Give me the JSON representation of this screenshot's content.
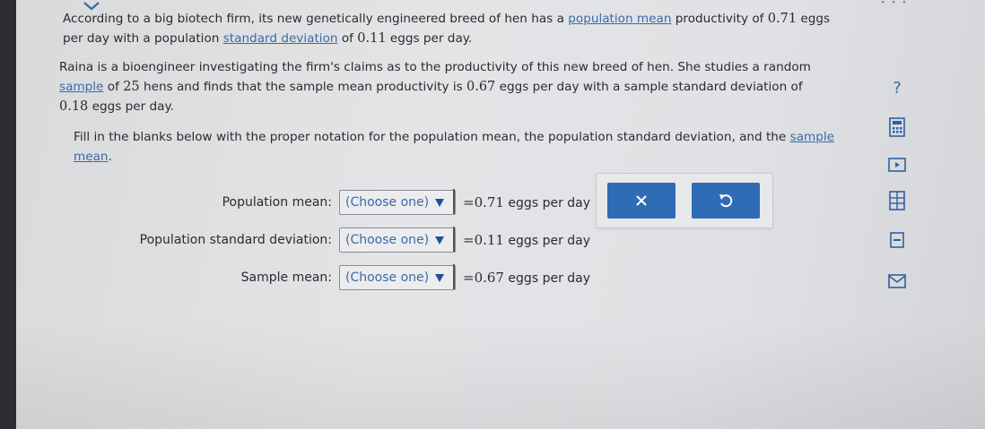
{
  "problem": {
    "p1_pre": "According to a big biotech firm, its new genetically engineered breed of hen has a ",
    "p1_link1": "population mean",
    "p1_mid1": " productivity of ",
    "p1_val1": "0.71",
    "p1_mid2": " eggs per day with a population ",
    "p1_link2": "standard deviation",
    "p1_mid3": " of ",
    "p1_val2": "0.11",
    "p1_end": " eggs per day.",
    "p2_pre": "Raina is a bioengineer investigating the firm's claims as to the productivity of this new breed of hen. She studies a random ",
    "p2_link": "sample",
    "p2_mid1": " of ",
    "p2_val1": "25",
    "p2_mid2": " hens and finds that the sample mean productivity is ",
    "p2_val2": "0.67",
    "p2_mid3": " eggs per day with a sample standard deviation of ",
    "p2_val3": "0.18",
    "p2_end": " eggs per day.",
    "p3_pre": "Fill in the blanks below with the proper notation for the population mean, the population standard deviation, and the ",
    "p3_link": "sample mean",
    "p3_end": "."
  },
  "rows": [
    {
      "label": "Population mean:",
      "choice": "(Choose one)",
      "eq": "=",
      "value": "0.71",
      "unit": " eggs per day"
    },
    {
      "label": "Population standard deviation:",
      "choice": "(Choose one)",
      "eq": "=",
      "value": "0.11",
      "unit": " eggs per day"
    },
    {
      "label": "Sample mean:",
      "choice": "(Choose one)",
      "eq": "=",
      "value": "0.67",
      "unit": " eggs per day"
    }
  ],
  "panel": {
    "clear_icon": "x-icon",
    "undo_icon": "undo-icon"
  },
  "toolbar": {
    "help": "?",
    "icons": [
      "help-icon",
      "calculator-icon",
      "video-icon",
      "data-table-icon",
      "glossary-icon",
      "mail-icon"
    ]
  },
  "colors": {
    "accent": "#2f6cb6",
    "link": "#3a6aa8",
    "text": "#2a2b2f"
  }
}
